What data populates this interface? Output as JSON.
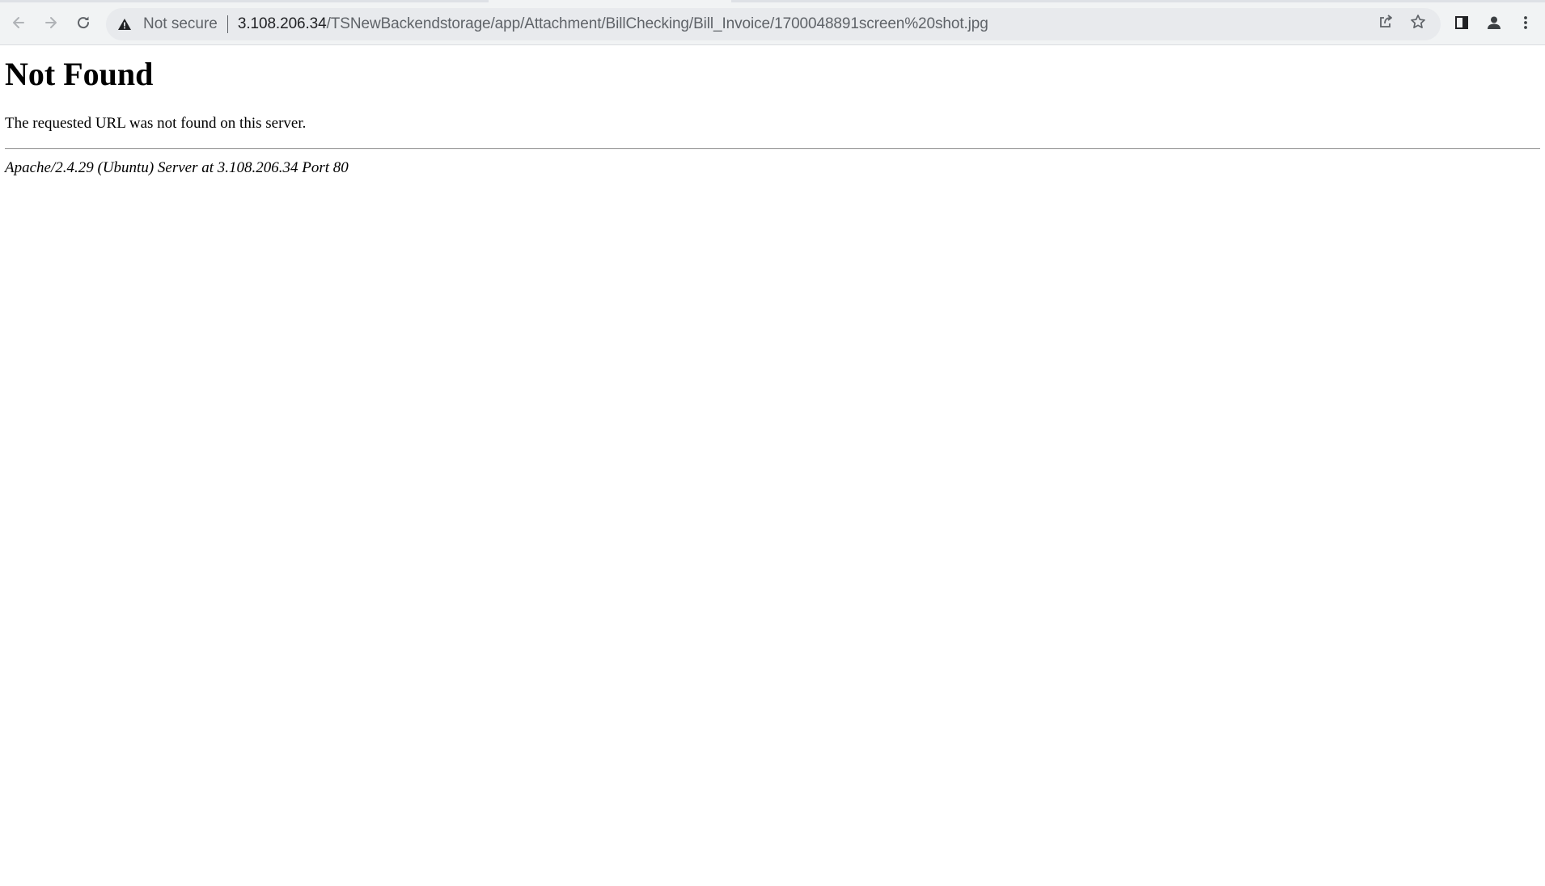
{
  "browser": {
    "security_label": "Not secure",
    "url_host": "3.108.206.34",
    "url_path": "/TSNewBackendstorage/app/Attachment/BillChecking/Bill_Invoice/1700048891screen%20shot.jpg",
    "icons": {
      "back": "arrow-left-icon",
      "forward": "arrow-right-icon",
      "reload": "reload-icon",
      "security": "warning-triangle-icon",
      "share": "share-icon",
      "bookmark": "star-icon",
      "side_panel": "side-panel-icon",
      "profile": "profile-icon",
      "menu": "kebab-menu-icon"
    }
  },
  "page": {
    "heading": "Not Found",
    "message": "The requested URL was not found on this server.",
    "server_signature": "Apache/2.4.29 (Ubuntu) Server at 3.108.206.34 Port 80"
  },
  "colors": {
    "toolbar_bg": "#f1f3f4",
    "omnibox_bg": "#e8eaed",
    "icon": "#5f6368",
    "icon_disabled": "#b0b3b7"
  }
}
